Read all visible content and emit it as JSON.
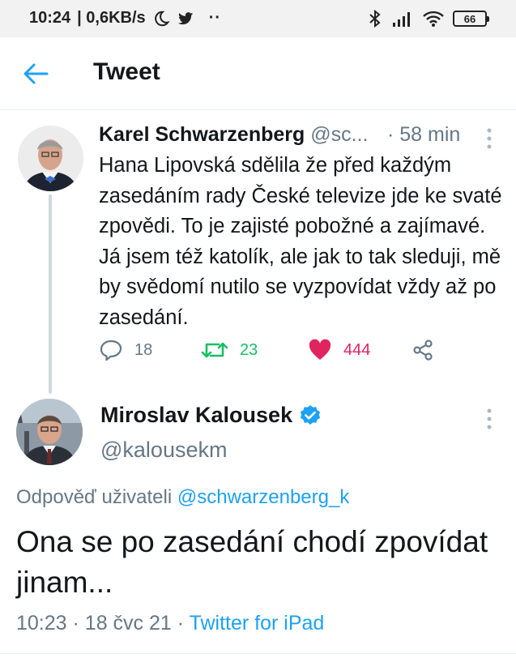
{
  "status_bar": {
    "time": "10:24",
    "speed": "| 0,6KB/s",
    "dots": "··",
    "battery": "66"
  },
  "header": {
    "title": "Tweet"
  },
  "parent_tweet": {
    "name": "Karel Schwarzenberg",
    "handle": "@sc...",
    "time": "· 58 min",
    "text": "Hana Lipovská sdělila že před každým zasedáním rady České televize jde ke svaté zpovědi. To je zajisté pobožné a zajímavé. Já jsem též katolík, ale jak to tak sleduji, mě by svědomí nutilo se vyzpovídat vždy až po zasedání.",
    "replies": "18",
    "retweets": "23",
    "likes": "444"
  },
  "main_tweet": {
    "name": "Miroslav Kalousek",
    "handle": "@kalousekm",
    "replying_prefix": "Odpověď uživateli",
    "replying_to": "@schwarzenberg_k",
    "text": "Ona se po zasedání chodí zpovídat jinam...",
    "time": "10:23",
    "separator1": "·",
    "date": "18 čvc 21",
    "separator2": "·",
    "source": "Twitter for iPad"
  },
  "colors": {
    "accent": "#1da1f2",
    "retweet": "#17bf63",
    "like": "#e0245e",
    "secondary_text": "#657786"
  }
}
